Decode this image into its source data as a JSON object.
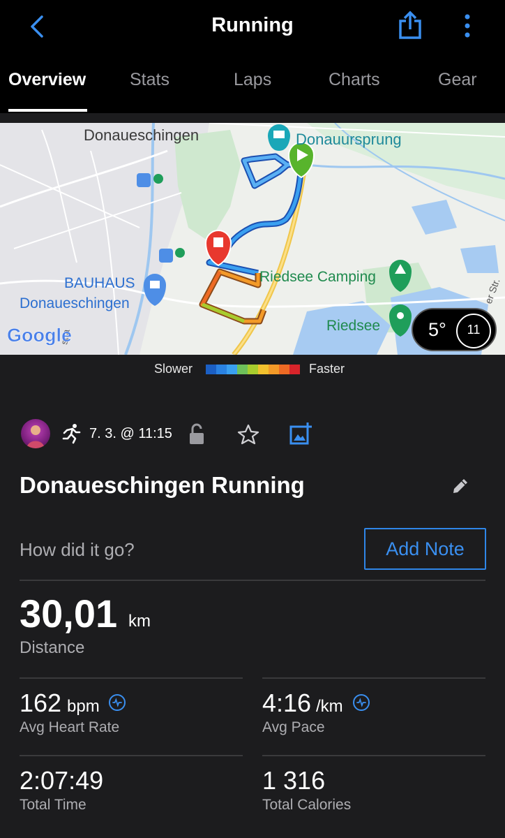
{
  "header": {
    "title": "Running",
    "back_icon": "chevron-left-icon",
    "share_icon": "share-icon",
    "more_icon": "more-vertical-icon",
    "accent": "#3a8ff0"
  },
  "tabs": [
    {
      "label": "Overview",
      "active": true
    },
    {
      "label": "Stats",
      "active": false
    },
    {
      "label": "Laps",
      "active": false
    },
    {
      "label": "Charts",
      "active": false
    },
    {
      "label": "Gear",
      "active": false
    }
  ],
  "map": {
    "labels": {
      "town": "Donaueschingen",
      "spring": "Donauursprung",
      "camping": "Riedsee Camping",
      "lake": "Riedsee",
      "bauhaus_line1": "BAUHAUS",
      "bauhaus_line2": "Donaueschingen",
      "road_partial": "er Str.",
      "street_partial": "stra",
      "logo": "Google"
    },
    "weather": {
      "temp": "5°",
      "wind": "11"
    },
    "start_marker": "play-marker-icon",
    "end_marker": "stop-marker-icon"
  },
  "legend": {
    "slower": "Slower",
    "faster": "Faster",
    "colors": [
      "#1b5fc4",
      "#2a82e2",
      "#3aa0f0",
      "#6ec05a",
      "#a8cc2e",
      "#f2c12e",
      "#f39a28",
      "#ee6a24",
      "#d8242a"
    ]
  },
  "activity": {
    "date": "7. 3. @ 11:15",
    "title": "Donaueschingen Running",
    "prompt": "How did it go?",
    "add_note": "Add Note"
  },
  "stats": {
    "distance": {
      "value": "30,01",
      "unit": "km",
      "label": "Distance"
    },
    "heart_rate": {
      "value": "162",
      "unit": "bpm",
      "label": "Avg Heart Rate"
    },
    "pace": {
      "value": "4:16",
      "unit": "/km",
      "label": "Avg Pace"
    },
    "time": {
      "value": "2:07:49",
      "label": "Total Time"
    },
    "calories": {
      "value": "1 316",
      "label": "Total Calories"
    }
  }
}
